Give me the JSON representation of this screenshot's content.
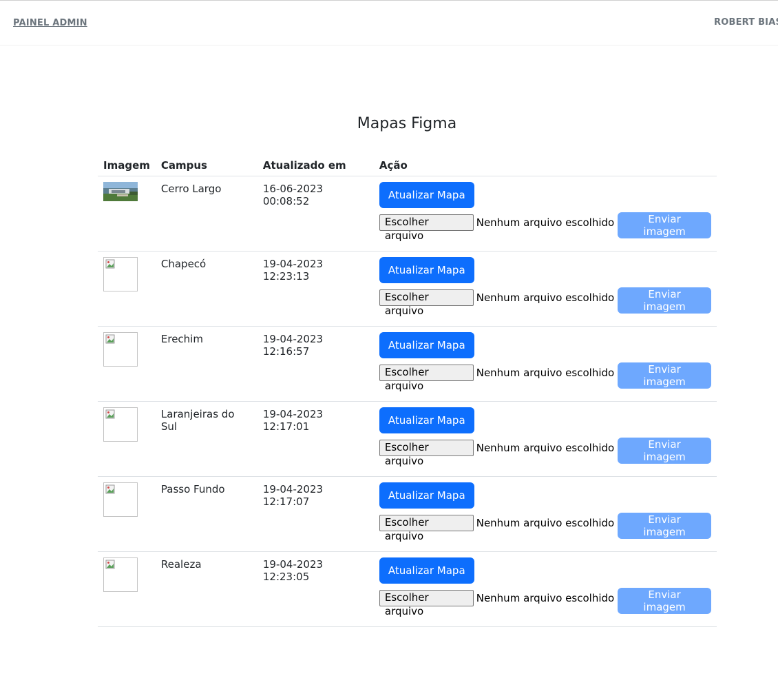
{
  "navbar": {
    "brand": "PAINEL ADMIN",
    "user": "ROBERT BIASO"
  },
  "page": {
    "title": "Mapas Figma"
  },
  "table": {
    "headers": {
      "image": "Imagem",
      "campus": "Campus",
      "updated": "Atualizado em",
      "action": "Ação"
    },
    "rows": [
      {
        "campus": "Cerro Largo",
        "updated": "16-06-2023 00:08:52",
        "has_image": true
      },
      {
        "campus": "Chapecó",
        "updated": "19-04-2023 12:23:13",
        "has_image": false
      },
      {
        "campus": "Erechim",
        "updated": "19-04-2023 12:16:57",
        "has_image": false
      },
      {
        "campus": "Laranjeiras do Sul",
        "updated": "19-04-2023 12:17:01",
        "has_image": false
      },
      {
        "campus": "Passo Fundo",
        "updated": "19-04-2023 12:17:07",
        "has_image": false
      },
      {
        "campus": "Realeza",
        "updated": "19-04-2023 12:23:05",
        "has_image": false
      }
    ],
    "actions": {
      "update_label": "Atualizar Mapa",
      "choose_file_label": "Escolher arquivo",
      "no_file_label": "Nenhum arquivo escolhido",
      "send_label": "Enviar imagem"
    }
  },
  "colors": {
    "primary": "#0d6efd",
    "primary_disabled": "#6ea8fe",
    "nav_text": "#6c757d"
  }
}
